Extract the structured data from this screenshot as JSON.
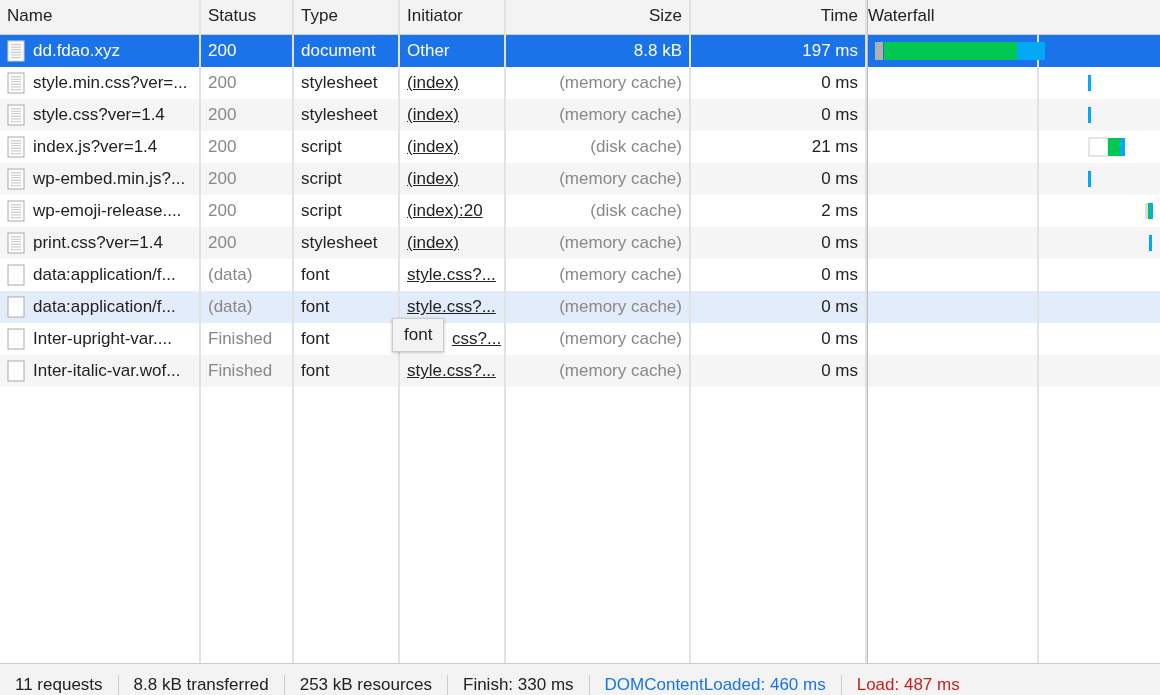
{
  "columns": [
    "Name",
    "Status",
    "Type",
    "Initiator",
    "Size",
    "Time",
    "Waterfall"
  ],
  "rows": [
    {
      "name": "dd.fdao.xyz",
      "kind": "document",
      "status": "200",
      "type": "document",
      "initiator": "Other",
      "link": false,
      "size": "8.8 kB",
      "time": "197 ms",
      "selected": true,
      "hovered": false
    },
    {
      "name": "style.min.css?ver=...",
      "kind": "document",
      "status": "200",
      "type": "stylesheet",
      "initiator": "(index)",
      "link": true,
      "size": "(memory cache)",
      "time": "0 ms",
      "selected": false,
      "hovered": false
    },
    {
      "name": "style.css?ver=1.4",
      "kind": "document",
      "status": "200",
      "type": "stylesheet",
      "initiator": "(index)",
      "link": true,
      "size": "(memory cache)",
      "time": "0 ms",
      "selected": false,
      "hovered": false
    },
    {
      "name": "index.js?ver=1.4",
      "kind": "document",
      "status": "200",
      "type": "script",
      "initiator": "(index)",
      "link": true,
      "size": "(disk cache)",
      "time": "21 ms",
      "selected": false,
      "hovered": false
    },
    {
      "name": "wp-embed.min.js?...",
      "kind": "document",
      "status": "200",
      "type": "script",
      "initiator": "(index)",
      "link": true,
      "size": "(memory cache)",
      "time": "0 ms",
      "selected": false,
      "hovered": false
    },
    {
      "name": "wp-emoji-release....",
      "kind": "document",
      "status": "200",
      "type": "script",
      "initiator": "(index):20",
      "link": true,
      "size": "(disk cache)",
      "time": "2 ms",
      "selected": false,
      "hovered": false
    },
    {
      "name": "print.css?ver=1.4",
      "kind": "document",
      "status": "200",
      "type": "stylesheet",
      "initiator": "(index)",
      "link": true,
      "size": "(memory cache)",
      "time": "0 ms",
      "selected": false,
      "hovered": false
    },
    {
      "name": "data:application/f...",
      "kind": "blank",
      "status": "(data)",
      "type": "font",
      "initiator": "style.css?...",
      "link": true,
      "size": "(memory cache)",
      "time": "0 ms",
      "selected": false,
      "hovered": false
    },
    {
      "name": "data:application/f...",
      "kind": "blank",
      "status": "(data)",
      "type": "font",
      "initiator": "style.css?...",
      "link": true,
      "size": "(memory cache)",
      "time": "0 ms",
      "selected": false,
      "hovered": true
    },
    {
      "name": "Inter-upright-var....",
      "kind": "blank",
      "status": "Finished",
      "type": "font",
      "initiator": "css?...",
      "link": true,
      "size": "(memory cache)",
      "time": "0 ms",
      "selected": false,
      "hovered": false,
      "tooltip": "font"
    },
    {
      "name": "Inter-italic-var.wof...",
      "kind": "blank",
      "status": "Finished",
      "type": "font",
      "initiator": "style.css?...",
      "link": true,
      "size": "(memory cache)",
      "time": "0 ms",
      "selected": false,
      "hovered": false
    }
  ],
  "status_bar": [
    {
      "text": "11 requests",
      "kind": "plain"
    },
    {
      "text": "8.8 kB transferred",
      "kind": "plain"
    },
    {
      "text": "253 kB resources",
      "kind": "plain"
    },
    {
      "text": "Finish: 330 ms",
      "kind": "plain"
    },
    {
      "text": "DOMContentLoaded: 460 ms",
      "kind": "dom"
    },
    {
      "text": "Load: 487 ms",
      "kind": "load"
    }
  ]
}
